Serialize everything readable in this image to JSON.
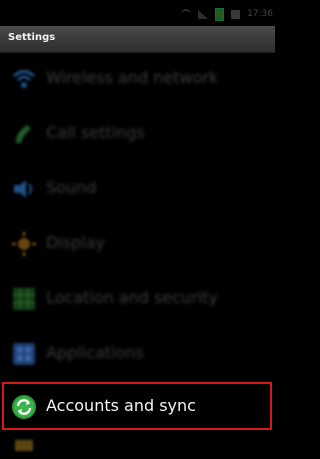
{
  "status_bar": {
    "time": "17:36"
  },
  "title_bar": {
    "title": "Settings"
  },
  "settings_items": [
    {
      "label": "Wireless and network",
      "icon": "wifi-icon"
    },
    {
      "label": "Call settings",
      "icon": "phone-icon"
    },
    {
      "label": "Sound",
      "icon": "speaker-icon"
    },
    {
      "label": "Display",
      "icon": "brightness-icon"
    },
    {
      "label": "Location and security",
      "icon": "location-grid-icon"
    },
    {
      "label": "Applications",
      "icon": "applications-icon"
    },
    {
      "label": "Accounts and sync",
      "icon": "sync-icon",
      "highlighted": true
    }
  ],
  "colors": {
    "highlight_border": "#d21a1a",
    "title_bar_bg": "#3c3c3c",
    "accent_green": "#3aa83a"
  }
}
